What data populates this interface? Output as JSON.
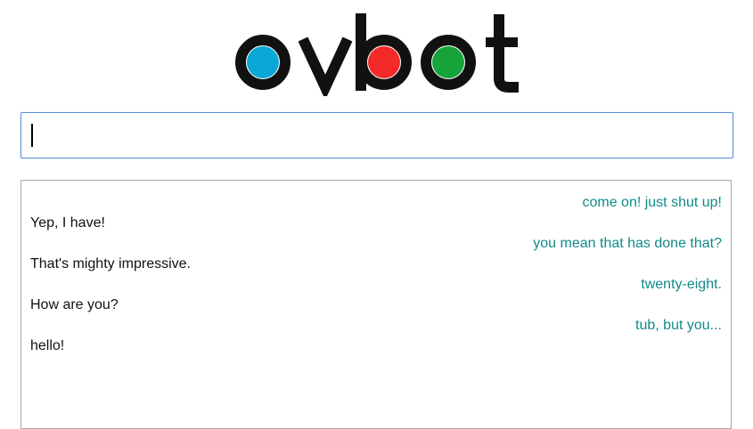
{
  "logo": {
    "text": "ovbot",
    "dot_colors": [
      "#0aa7d6",
      "#f42a2a",
      "#16a33a"
    ],
    "letter_color": "#111111"
  },
  "input": {
    "value": "",
    "placeholder": ""
  },
  "colors": {
    "bot_text": "#118a8a",
    "user_text": "#111111",
    "input_border": "#5b8fd8",
    "log_border": "#a8a8a8"
  },
  "messages": [
    {
      "speaker": "bot",
      "text": "come on! just shut up!"
    },
    {
      "speaker": "user",
      "text": "Yep, I have!"
    },
    {
      "speaker": "bot",
      "text": "you mean that has done that?"
    },
    {
      "speaker": "user",
      "text": "That's mighty impressive."
    },
    {
      "speaker": "bot",
      "text": "twenty-eight."
    },
    {
      "speaker": "user",
      "text": "How are you?"
    },
    {
      "speaker": "bot",
      "text": "tub, but you..."
    },
    {
      "speaker": "user",
      "text": "hello!"
    }
  ]
}
